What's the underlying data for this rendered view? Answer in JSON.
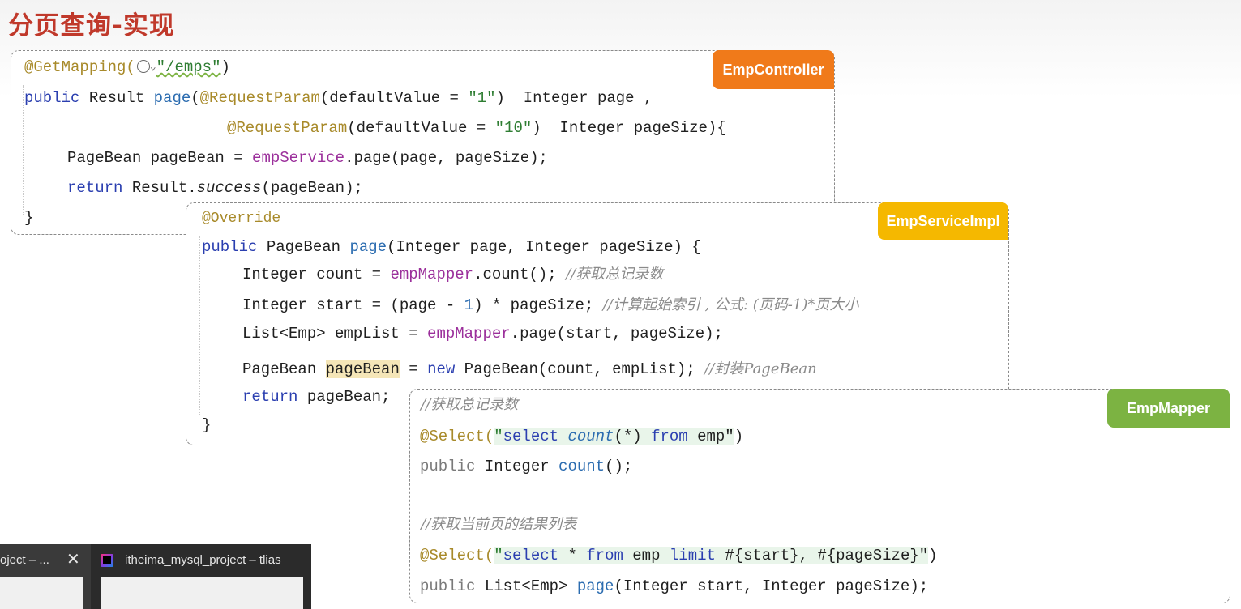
{
  "slide": {
    "title": "分页查询-实现"
  },
  "controller": {
    "tag": "EmpController",
    "tag_color": "#f07a1a",
    "lines": {
      "l1_ann": "@GetMapping(",
      "l1_path": "\"/emps\"",
      "l1_end": ")",
      "l2_kw": "public",
      "l2_a": " Result ",
      "l2_fn": "page",
      "l2_b": "(",
      "l2_ann": "@RequestParam",
      "l2_c": "(defaultValue = ",
      "l2_str": "\"1\"",
      "l2_d": ")  Integer page ,",
      "l3_ann": "@RequestParam",
      "l3_c": "(defaultValue = ",
      "l3_str": "\"10\"",
      "l3_d": ")  Integer pageSize){",
      "l4_a": "PageBean pageBean = ",
      "l4_fld": "empService",
      "l4_b": ".page(page, pageSize);",
      "l5_kw": "return",
      "l5_a": " Result.",
      "l5_it": "success",
      "l5_b": "(pageBean);",
      "l6": "}"
    }
  },
  "service": {
    "tag": "EmpServiceImpl",
    "tag_color": "#f5b800",
    "lines": {
      "l1_ann": "@Override",
      "l2_kw": "public",
      "l2_a": " PageBean ",
      "l2_fn": "page",
      "l2_b": "(Integer page, Integer pageSize) {",
      "l3_a": "Integer count = ",
      "l3_fld": "empMapper",
      "l3_b": ".count(); ",
      "l3_cm": "//获取总记录数",
      "l4_a": "Integer start = (page - ",
      "l4_num": "1",
      "l4_b": ") * pageSize; ",
      "l4_cm": "//计算起始索引 , 公式: (页码-1)*页大小",
      "l5_a": "List<Emp> empList = ",
      "l5_fld": "empMapper",
      "l5_b": ".page(start, pageSize);",
      "l6_a": "PageBean ",
      "l6_hl": "pageBean",
      "l6_b": " = ",
      "l6_kw": "new",
      "l6_c": " PageBean(count, empList); ",
      "l6_cm": "//封装PageBean",
      "l7_kw": "return",
      "l7_a": " pageBean;",
      "l8": "}"
    }
  },
  "mapper": {
    "tag": "EmpMapper",
    "tag_color": "#7cb342",
    "lines": {
      "l1_cm": "//获取总记录数",
      "l2_ann": "@Select(",
      "l2_q1": "\"",
      "l2_kw1": "select",
      "l2_sp": " ",
      "l2_it": "count",
      "l2_q2": "(*) ",
      "l2_kw2": "from",
      "l2_q3": " emp\"",
      "l2_end": ")",
      "l3_kw": "public",
      "l3_a": " Integer ",
      "l3_fn": "count",
      "l3_b": "();",
      "l4_cm": "//获取当前页的结果列表",
      "l5_ann": "@Select(",
      "l5_q1": "\"",
      "l5_kw1": "select",
      "l5_a": " * ",
      "l5_kw2": "from",
      "l5_b": " emp ",
      "l5_kw3": "limit",
      "l5_c": " #{start}, #{pageSize}\"",
      "l5_end": ")",
      "l6_kw": "public",
      "l6_a": " List<Emp> ",
      "l6_fn": "page",
      "l6_b": "(Integer start, Integer pageSize);"
    }
  },
  "taskbar": {
    "item1_label": "oject – ...",
    "item1_close": "✕",
    "item2_label": "itheima_mysql_project – tlias"
  }
}
